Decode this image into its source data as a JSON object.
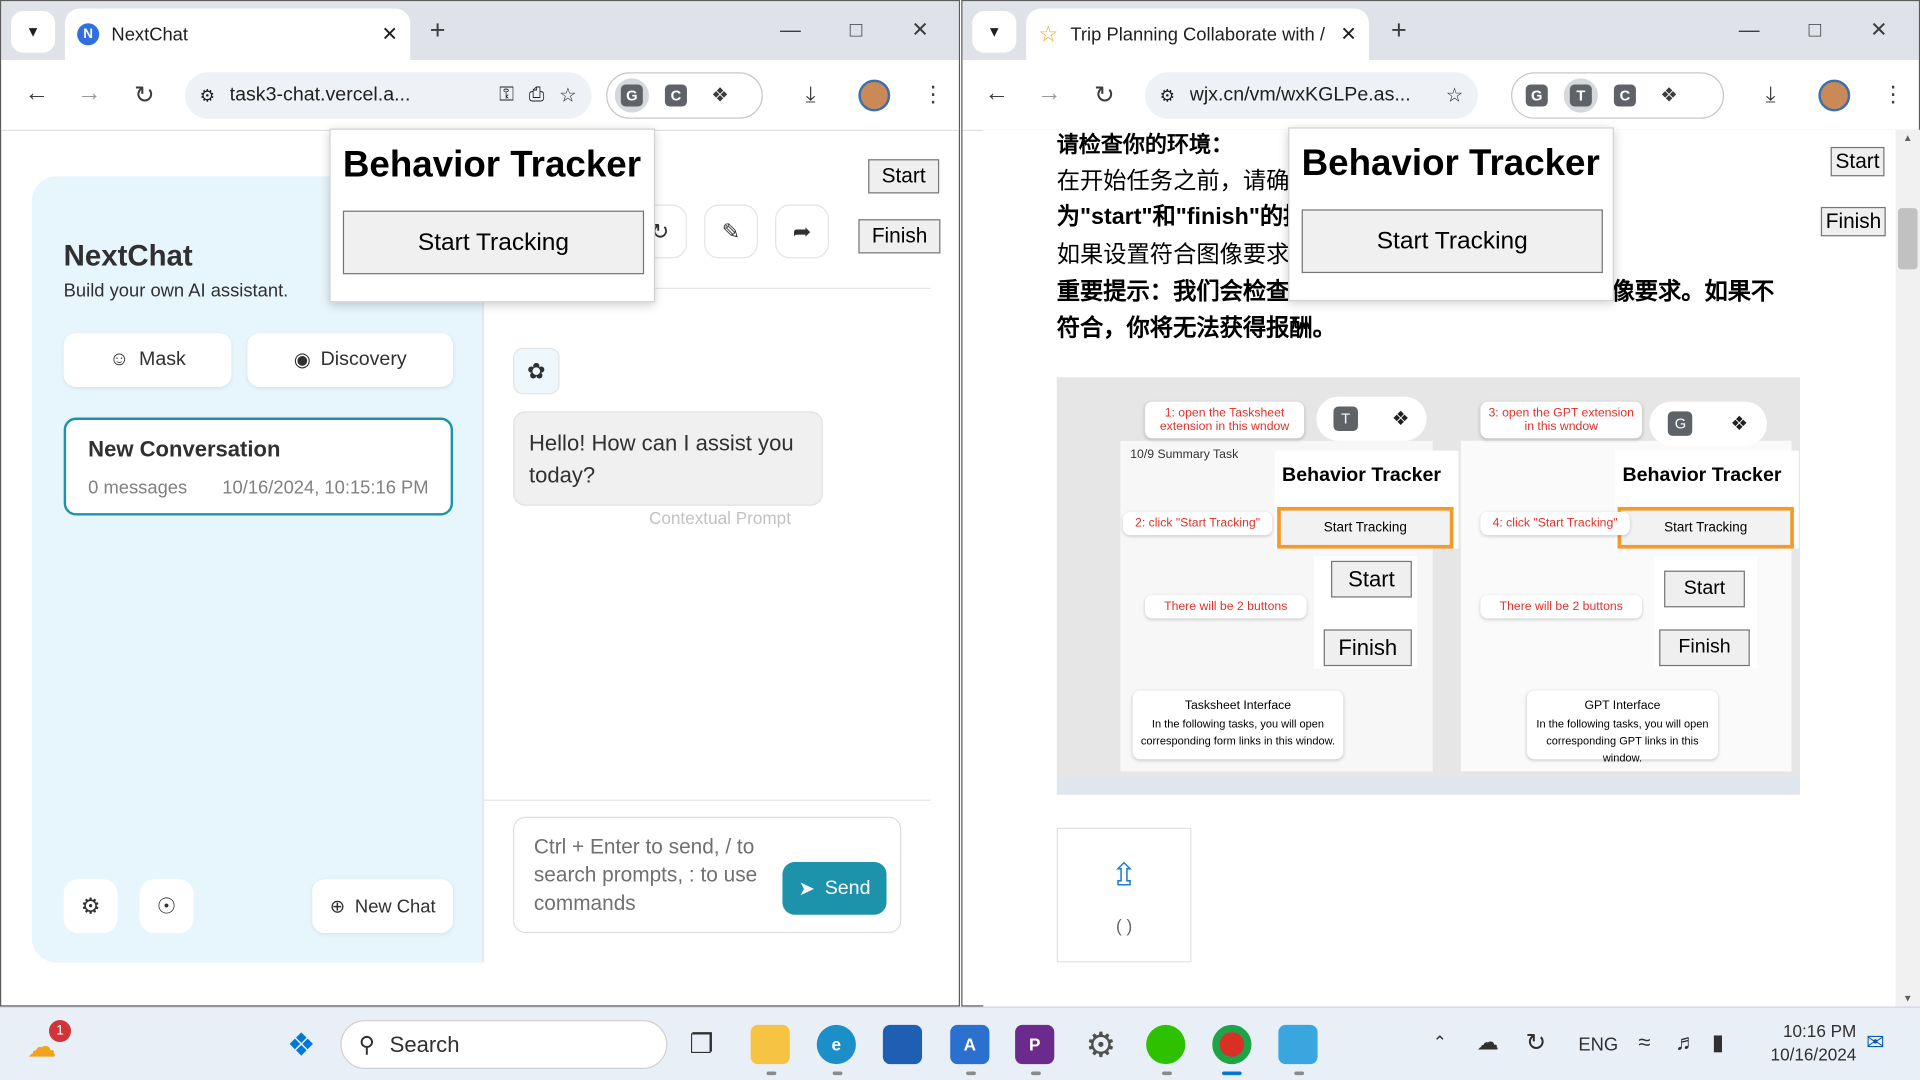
{
  "left": {
    "tab_title": "NextChat",
    "url": "task3-chat.vercel.a...",
    "ext_g": "G",
    "ext_c": "C",
    "tracker": {
      "title": "Behavior Tracker",
      "button": "Start Tracking"
    },
    "start": "Start",
    "finish": "Finish",
    "app": {
      "title": "NextChat",
      "subtitle": "Build your own AI assistant.",
      "mask": "Mask",
      "discovery": "Discovery",
      "conversation": {
        "title": "New Conversation",
        "count": "0 messages",
        "date": "10/16/2024, 10:15:16 PM"
      },
      "new_chat": "New Chat",
      "greeting": "Hello! How can I assist you today?",
      "contextual": "Contextual Prompt",
      "placeholder": "Ctrl + Enter to send, / to search prompts, : to use commands",
      "send": "Send"
    }
  },
  "right": {
    "tab_title": "Trip Planning Collaborate with /",
    "url": "wjx.cn/vm/wxKGLPe.as...",
    "ext_g": "G",
    "ext_t": "T",
    "ext_c": "C",
    "tracker": {
      "title": "Behavior Tracker",
      "button": "Start Tracking"
    },
    "start": "Start",
    "finish": "Finish",
    "lines": [
      "请检查你的环境：",
      "在开始任务之前，请确",
      "为\"start\"和\"finish\"的按",
      "如果设置符合图像要求",
      "重要提示：我们会检查",
      "像要求。如果不",
      "符合，你将无法获得报酬。"
    ],
    "upload_caption": "( )",
    "screenshot": {
      "label1": "1: open the Tasksheet extension in this wndow",
      "label2": "2: click \"Start Tracking\"",
      "label3": "3: open the GPT extension in this wndow",
      "label4": "4: click \"Start Tracking\"",
      "two_buttons": "There will be 2 buttons",
      "tracker": "Behavior Tracker",
      "start_tracking": "Start Tracking",
      "start": "Start",
      "finish": "Finish",
      "task_summary": "10/9 Summary Task",
      "tasksheet_title": "Tasksheet Interface",
      "tasksheet_body": "In the following tasks, you will open corresponding form links in this window.",
      "gpt_title": "GPT Interface",
      "gpt_body": "In the following tasks, you will open corresponding GPT links in this window.",
      "ext_t": "T",
      "ext_g": "G"
    }
  },
  "taskbar": {
    "search": "Search",
    "lang": "ENG",
    "time": "10:16 PM",
    "date": "10/16/2024",
    "weather_badge": "1"
  }
}
